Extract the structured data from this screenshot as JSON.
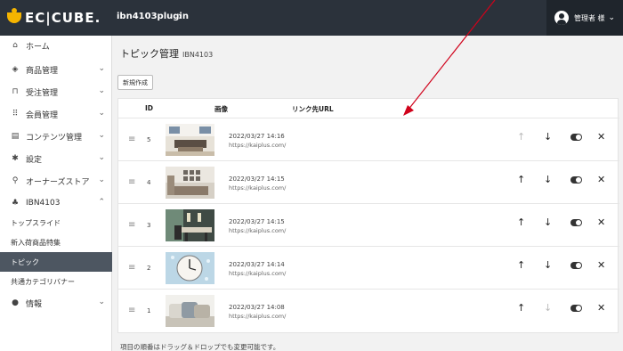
{
  "header": {
    "logo_text": "EC|CUBE.",
    "shop_title": "ibn4103plugin",
    "shop_chevron": "›",
    "user_name": "管理者 様",
    "user_chevron": "⌄"
  },
  "sidebar": {
    "items": [
      {
        "icon": "home-icon",
        "glyph": "⌂",
        "label": "ホーム",
        "chevron": ""
      },
      {
        "icon": "cube-icon",
        "glyph": "◈",
        "label": "商品管理",
        "chevron": "⌄"
      },
      {
        "icon": "cart-icon",
        "glyph": "⊓",
        "label": "受注管理",
        "chevron": "⌄"
      },
      {
        "icon": "users-icon",
        "glyph": "⠿",
        "label": "会員管理",
        "chevron": "⌄"
      },
      {
        "icon": "document-icon",
        "glyph": "▤",
        "label": "コンテンツ管理",
        "chevron": "⌄"
      },
      {
        "icon": "gear-icon",
        "glyph": "✱",
        "label": "設定",
        "chevron": "⌄"
      },
      {
        "icon": "plug-icon",
        "glyph": "⚲",
        "label": "オーナーズストア",
        "chevron": "⌄"
      },
      {
        "icon": "puzzle-icon",
        "glyph": "♣",
        "label": "IBN4103",
        "chevron": "⌃"
      }
    ],
    "subitems": [
      {
        "label": "トップスライド",
        "active": false
      },
      {
        "label": "新入荷商品特集",
        "active": false
      },
      {
        "label": "トピック",
        "active": true
      },
      {
        "label": "共通カテゴリバナー",
        "active": false
      }
    ],
    "info": {
      "icon": "info-icon",
      "glyph": "●",
      "label": "情報",
      "chevron": "⌄"
    }
  },
  "main": {
    "title": "トピック管理",
    "subtitle": "IBN4103",
    "new_button": "新規作成",
    "columns": {
      "id": "ID",
      "image": "画像",
      "url": "リンク先URL"
    },
    "rows": [
      {
        "id": "5",
        "date": "2022/03/27 14:16",
        "url": "https://kaiplus.com/",
        "image": "living-room"
      },
      {
        "id": "4",
        "date": "2022/03/27 14:15",
        "url": "https://kaiplus.com/",
        "image": "kitchen"
      },
      {
        "id": "3",
        "date": "2022/03/27 14:15",
        "url": "https://kaiplus.com/",
        "image": "dining-room"
      },
      {
        "id": "2",
        "date": "2022/03/27 14:14",
        "url": "https://kaiplus.com/",
        "image": "wall-clock"
      },
      {
        "id": "1",
        "date": "2022/03/27 14:08",
        "url": "https://kaiplus.com/",
        "image": "pillows"
      }
    ],
    "drag_glyph": "≡",
    "up_glyph": "↑",
    "down_glyph": "↓",
    "delete_glyph": "✕",
    "hint": "項目の順番はドラッグ＆ドロップでも変更可能です。"
  },
  "colors": {
    "header_bg": "#2b323b",
    "active_nav": "#4d5661",
    "accent_logo": "#f5b400",
    "annotation_arrow": "#d0021b"
  }
}
